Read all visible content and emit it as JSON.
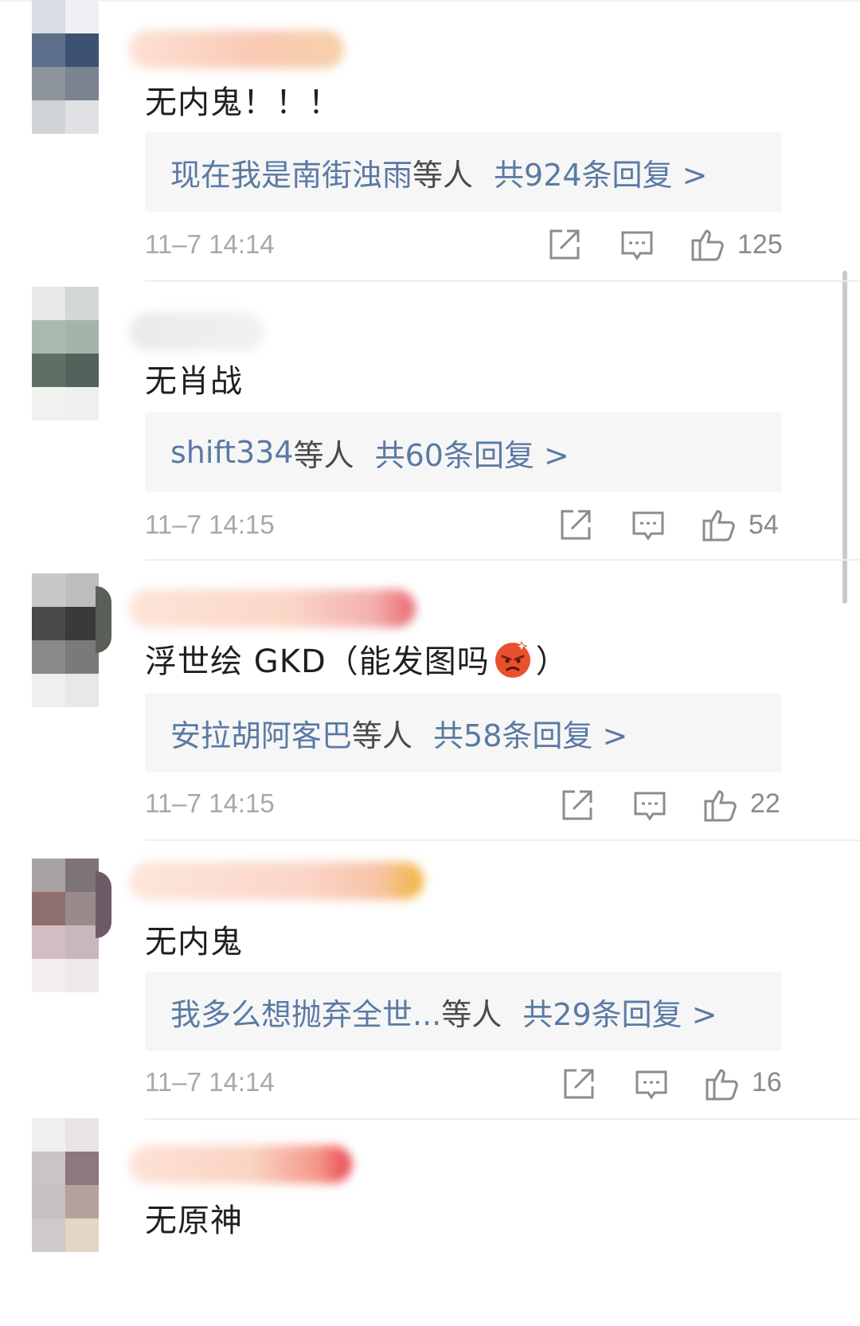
{
  "comments": [
    {
      "text": "无内鬼！！！",
      "reply_users": "现在我是南街浊雨",
      "reply_etal": "等人",
      "reply_count": "共924条回复 >",
      "time": "11–7 14:14",
      "likes": "125",
      "avatar_colors": [
        "#d9dde3",
        "#eef0f3",
        "#5c708c",
        "#3c5270",
        "#8f959c",
        "#7b8290",
        "#cfd2d6",
        "#dfe1e4"
      ],
      "name_blur_colors": [
        "#f9c9b4",
        "#f7d0a8"
      ]
    },
    {
      "text": "无肖战",
      "reply_users": "shift334",
      "reply_etal": "等人",
      "reply_count": "共60条回复 >",
      "time": "11–7 14:15",
      "likes": "54",
      "avatar_colors": [
        "#e6e9e6",
        "#d3d8d4",
        "#a9b9ad",
        "#a4b4a8",
        "#5f6f64",
        "#52615a",
        "#f0f2f0",
        "#eef0ee"
      ],
      "name_blur_colors": [
        "#e9eaea",
        "#f1f1f1"
      ]
    },
    {
      "text_before": "浮世绘 GKD（能发图吗",
      "text_after": "）",
      "reply_users": "安拉胡阿客巴",
      "reply_etal": "等人",
      "reply_count": "共58条回复 >",
      "time": "11–7 14:15",
      "likes": "22",
      "avatar_colors": [
        "#c8c8c8",
        "#bdbdbd",
        "#4a4a4a",
        "#3a3a3a",
        "#8a8a8a",
        "#7a7a7a",
        "#efefef",
        "#e8e8e8"
      ],
      "name_blur_colors": [
        "#fbd7c6",
        "#f3b0ae"
      ]
    },
    {
      "text": "无内鬼",
      "reply_users": "我多么想抛弃全世...",
      "reply_etal": "等人",
      "reply_count": "共29条回复 >",
      "time": "11–7 14:14",
      "likes": "16",
      "avatar_colors": [
        "#a8a2a4",
        "#7d7476",
        "#8e6e6e",
        "#9a8a8c",
        "#d4bcc6",
        "#c8b7bf",
        "#f2eef0",
        "#eeeaec"
      ],
      "name_blur_colors": [
        "#fbd5c7",
        "#f7c3a4"
      ]
    },
    {
      "text": "无原神",
      "avatar_colors": [
        "#f1eff0",
        "#e8e4e6",
        "#c9c4c6",
        "#8c787e",
        "#c6c0c4",
        "#b6a29c",
        "#cfc9cb",
        "#e2d6c4"
      ],
      "name_blur_colors": [
        "#fad3c2",
        "#f49688"
      ]
    }
  ],
  "colors": {
    "link": "#5a7aa3",
    "reply_bg": "#f6f6f7",
    "meta": "#a8a8a8",
    "icon": "#8c8c8c"
  },
  "icons": [
    "share-icon",
    "comment-icon",
    "like-icon",
    "angry-emoji-icon"
  ]
}
